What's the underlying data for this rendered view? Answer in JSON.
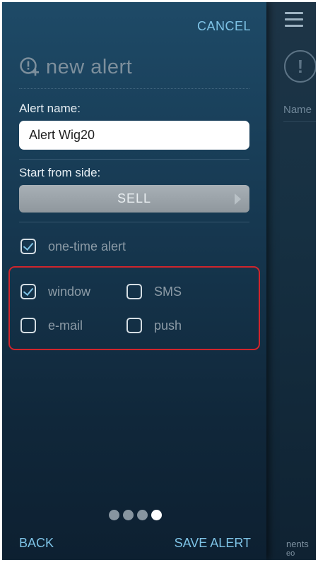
{
  "header": {
    "cancel_label": "CANCEL",
    "title": "new alert"
  },
  "form": {
    "alert_name_label": "Alert name:",
    "alert_name_value": "Alert Wig20",
    "start_side_label": "Start from side:",
    "start_side_value": "SELL"
  },
  "options": {
    "one_time": {
      "label": "one-time alert",
      "checked": true
    },
    "window": {
      "label": "window",
      "checked": true
    },
    "sms": {
      "label": "SMS",
      "checked": false
    },
    "email": {
      "label": "e-mail",
      "checked": false
    },
    "push": {
      "label": "push",
      "checked": false
    }
  },
  "pager": {
    "total": 4,
    "active_index": 3
  },
  "footer": {
    "back_label": "BACK",
    "save_label": "SAVE ALERT"
  },
  "background_screen": {
    "column_header": "Name",
    "footer_line1": "nents",
    "footer_line2": "eo"
  },
  "colors": {
    "accent": "#7ec3e6",
    "highlight": "#d0252c",
    "panel_top": "#1e4a67",
    "panel_bottom": "#0d2031"
  }
}
